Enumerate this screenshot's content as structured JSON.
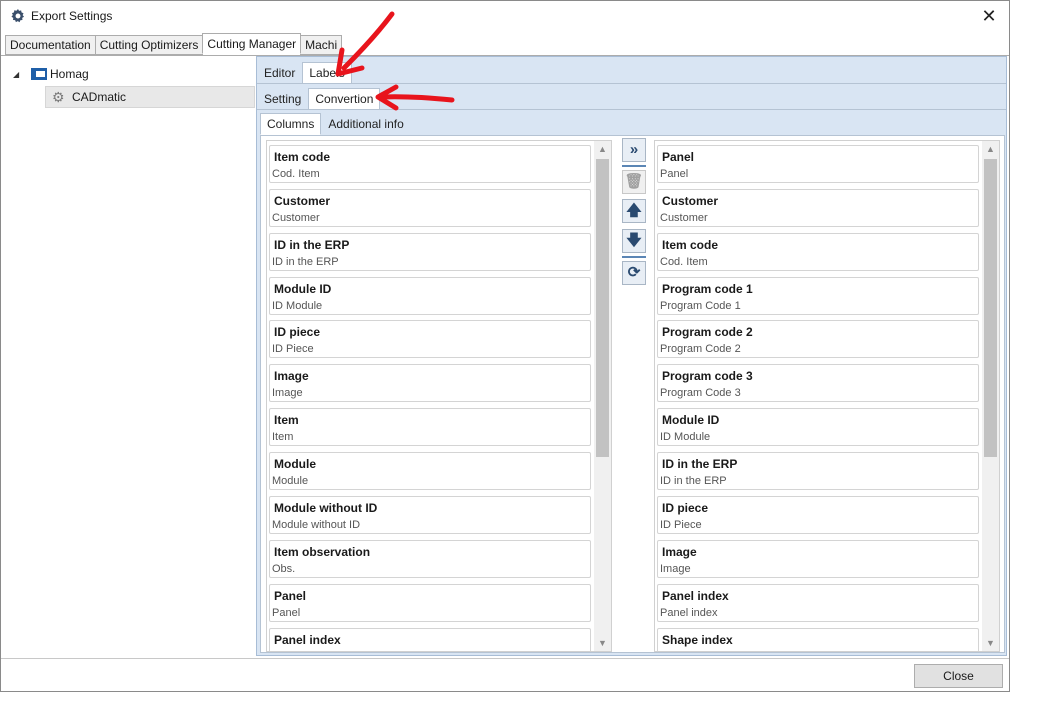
{
  "window": {
    "title": "Export Settings",
    "close_glyph": "✕"
  },
  "top_tabs": [
    "Documentation",
    "Cutting Optimizers",
    "Cutting Manager",
    "Machi"
  ],
  "tree": {
    "root": "Homag",
    "child": "CADmatic"
  },
  "editor_tabs": [
    "Editor",
    "Labels"
  ],
  "setting_tabs": [
    "Setting",
    "Convertion"
  ],
  "column_tabs": [
    "Columns",
    "Additional info"
  ],
  "left_list": [
    {
      "title": "Item code",
      "sub": "Cod. Item"
    },
    {
      "title": "Customer",
      "sub": "Customer"
    },
    {
      "title": "ID in the ERP",
      "sub": "ID in the ERP"
    },
    {
      "title": "Module ID",
      "sub": "ID Module"
    },
    {
      "title": "ID piece",
      "sub": "ID Piece"
    },
    {
      "title": "Image",
      "sub": "Image"
    },
    {
      "title": "Item",
      "sub": "Item"
    },
    {
      "title": "Module",
      "sub": "Module"
    },
    {
      "title": "Module without ID",
      "sub": "Module without ID"
    },
    {
      "title": "Item observation",
      "sub": "Obs."
    },
    {
      "title": "Panel",
      "sub": "Panel"
    },
    {
      "title": "Panel index",
      "sub": ""
    }
  ],
  "right_list": [
    {
      "title": "Panel",
      "sub": "Panel"
    },
    {
      "title": "Customer",
      "sub": "Customer"
    },
    {
      "title": "Item code",
      "sub": "Cod. Item"
    },
    {
      "title": "Program code 1",
      "sub": "Program Code 1"
    },
    {
      "title": "Program code 2",
      "sub": "Program Code 2"
    },
    {
      "title": "Program code 3",
      "sub": "Program Code 3"
    },
    {
      "title": "Module ID",
      "sub": "ID Module"
    },
    {
      "title": "ID in the ERP",
      "sub": "ID in the ERP"
    },
    {
      "title": "ID piece",
      "sub": "ID Piece"
    },
    {
      "title": "Image",
      "sub": "Image"
    },
    {
      "title": "Panel index",
      "sub": "Panel index"
    },
    {
      "title": "Shape index",
      "sub": ""
    }
  ],
  "mid_buttons": {
    "add_all": "»",
    "delete": "🗑",
    "move_up": "🡅",
    "move_down": "🡇",
    "reset": "⟳"
  },
  "footer": {
    "close_label": "Close"
  },
  "colors": {
    "annotation_arrow": "#e8141c",
    "panel_bg": "#d9e5f3"
  }
}
